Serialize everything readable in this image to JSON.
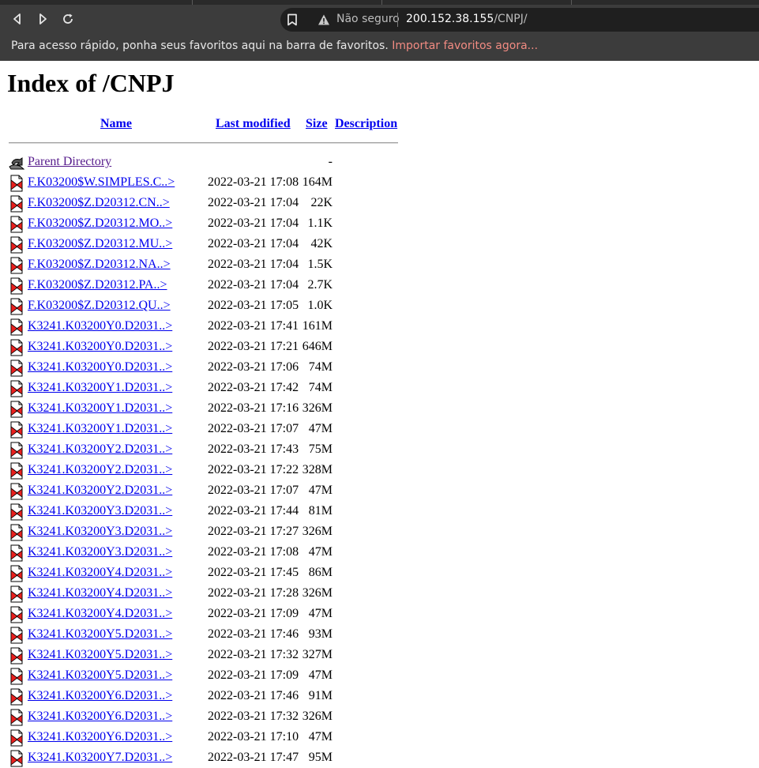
{
  "browser": {
    "security_label": "Não seguro",
    "url_host": "200.152.38.155",
    "url_path": "/CNPJ/",
    "bookmarks_prompt": "Para acesso rápido, ponha seus favoritos aqui na barra de favoritos.",
    "bookmarks_import_link": "Importar favoritos agora...",
    "link_color": "#f28b82"
  },
  "page": {
    "title": "Index of /CNPJ",
    "columns": {
      "name": "Name",
      "last_modified": "Last modified",
      "size": "Size",
      "description": "Description"
    },
    "parent": {
      "name": "Parent Directory",
      "size": "-"
    },
    "files": [
      {
        "name": "F.K03200$W.SIMPLES.C..>",
        "modified": "2022-03-21 17:08",
        "size": "164M"
      },
      {
        "name": "F.K03200$Z.D20312.CN..>",
        "modified": "2022-03-21 17:04",
        "size": "22K"
      },
      {
        "name": "F.K03200$Z.D20312.MO..>",
        "modified": "2022-03-21 17:04",
        "size": "1.1K"
      },
      {
        "name": "F.K03200$Z.D20312.MU..>",
        "modified": "2022-03-21 17:04",
        "size": "42K"
      },
      {
        "name": "F.K03200$Z.D20312.NA..>",
        "modified": "2022-03-21 17:04",
        "size": "1.5K"
      },
      {
        "name": "F.K03200$Z.D20312.PA..>",
        "modified": "2022-03-21 17:04",
        "size": "2.7K"
      },
      {
        "name": "F.K03200$Z.D20312.QU..>",
        "modified": "2022-03-21 17:05",
        "size": "1.0K"
      },
      {
        "name": "K3241.K03200Y0.D2031..>",
        "modified": "2022-03-21 17:41",
        "size": "161M"
      },
      {
        "name": "K3241.K03200Y0.D2031..>",
        "modified": "2022-03-21 17:21",
        "size": "646M"
      },
      {
        "name": "K3241.K03200Y0.D2031..>",
        "modified": "2022-03-21 17:06",
        "size": "74M"
      },
      {
        "name": "K3241.K03200Y1.D2031..>",
        "modified": "2022-03-21 17:42",
        "size": "74M"
      },
      {
        "name": "K3241.K03200Y1.D2031..>",
        "modified": "2022-03-21 17:16",
        "size": "326M"
      },
      {
        "name": "K3241.K03200Y1.D2031..>",
        "modified": "2022-03-21 17:07",
        "size": "47M"
      },
      {
        "name": "K3241.K03200Y2.D2031..>",
        "modified": "2022-03-21 17:43",
        "size": "75M"
      },
      {
        "name": "K3241.K03200Y2.D2031..>",
        "modified": "2022-03-21 17:22",
        "size": "328M"
      },
      {
        "name": "K3241.K03200Y2.D2031..>",
        "modified": "2022-03-21 17:07",
        "size": "47M"
      },
      {
        "name": "K3241.K03200Y3.D2031..>",
        "modified": "2022-03-21 17:44",
        "size": "81M"
      },
      {
        "name": "K3241.K03200Y3.D2031..>",
        "modified": "2022-03-21 17:27",
        "size": "326M"
      },
      {
        "name": "K3241.K03200Y3.D2031..>",
        "modified": "2022-03-21 17:08",
        "size": "47M"
      },
      {
        "name": "K3241.K03200Y4.D2031..>",
        "modified": "2022-03-21 17:45",
        "size": "86M"
      },
      {
        "name": "K3241.K03200Y4.D2031..>",
        "modified": "2022-03-21 17:28",
        "size": "326M"
      },
      {
        "name": "K3241.K03200Y4.D2031..>",
        "modified": "2022-03-21 17:09",
        "size": "47M"
      },
      {
        "name": "K3241.K03200Y5.D2031..>",
        "modified": "2022-03-21 17:46",
        "size": "93M"
      },
      {
        "name": "K3241.K03200Y5.D2031..>",
        "modified": "2022-03-21 17:32",
        "size": "327M"
      },
      {
        "name": "K3241.K03200Y5.D2031..>",
        "modified": "2022-03-21 17:09",
        "size": "47M"
      },
      {
        "name": "K3241.K03200Y6.D2031..>",
        "modified": "2022-03-21 17:46",
        "size": "91M"
      },
      {
        "name": "K3241.K03200Y6.D2031..>",
        "modified": "2022-03-21 17:32",
        "size": "326M"
      },
      {
        "name": "K3241.K03200Y6.D2031..>",
        "modified": "2022-03-21 17:10",
        "size": "47M"
      },
      {
        "name": "K3241.K03200Y7.D2031..>",
        "modified": "2022-03-21 17:47",
        "size": "95M"
      }
    ]
  }
}
